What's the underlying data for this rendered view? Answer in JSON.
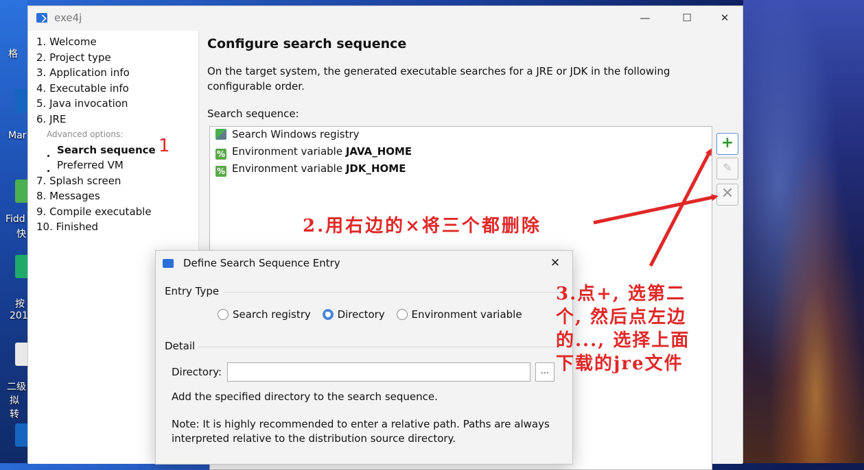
{
  "window": {
    "title": "exe4j",
    "minimize": "—",
    "maximize": "☐",
    "close": "✕"
  },
  "sidebar": {
    "steps": [
      {
        "label": "1. Welcome"
      },
      {
        "label": "2. Project type"
      },
      {
        "label": "3. Application info"
      },
      {
        "label": "4. Executable info"
      },
      {
        "label": "5. Java invocation"
      },
      {
        "label": "6. JRE"
      },
      {
        "label": "Advanced options:"
      },
      {
        "label": "Search sequence"
      },
      {
        "label": "Preferred VM"
      },
      {
        "label": "7. Splash screen"
      },
      {
        "label": "8. Messages"
      },
      {
        "label": "9. Compile executable"
      },
      {
        "label": "10. Finished"
      }
    ]
  },
  "main": {
    "heading": "Configure search sequence",
    "description": "On the target system, the generated executable searches for a JRE or JDK in the following configurable order.",
    "sequence_label": "Search sequence:",
    "sequence": [
      {
        "prefix": "Search Windows registry",
        "bold": "",
        "icon": "registry-icon"
      },
      {
        "prefix": "Environment variable ",
        "bold": "JAVA_HOME",
        "icon": "env-var-icon"
      },
      {
        "prefix": "Environment variable ",
        "bold": "JDK_HOME",
        "icon": "env-var-icon"
      }
    ],
    "buttons": {
      "add": "+",
      "edit": "✎",
      "delete": "✕"
    }
  },
  "dialog": {
    "title": "Define Search Sequence Entry",
    "close": "✕",
    "entry_type_label": "Entry Type",
    "radios": [
      {
        "label": "Search registry",
        "selected": false
      },
      {
        "label": "Directory",
        "selected": true
      },
      {
        "label": "Environment variable",
        "selected": false
      }
    ],
    "detail_label": "Detail",
    "directory_label": "Directory:",
    "directory_value": "",
    "browse_label": "...",
    "help_text": "Add the specified directory to the search sequence.",
    "note_text": "Note: It is highly recommended to enter a relative path. Paths are always interpreted relative to the distribution source directory."
  },
  "annotations": {
    "a1": "1",
    "a2": "2.用右边的×将三个都删除",
    "a3_line1": "3.点+, 选第二",
    "a3_line2": "个, 然后点左边",
    "a3_line3": "的..., 选择上面",
    "a3_line4": "下载的jre文件",
    "color": "#e02828"
  },
  "desktop": {
    "labels": [
      "格",
      "Mar",
      "Fidd",
      "快",
      "按",
      "201",
      "二级",
      "拟转"
    ]
  }
}
